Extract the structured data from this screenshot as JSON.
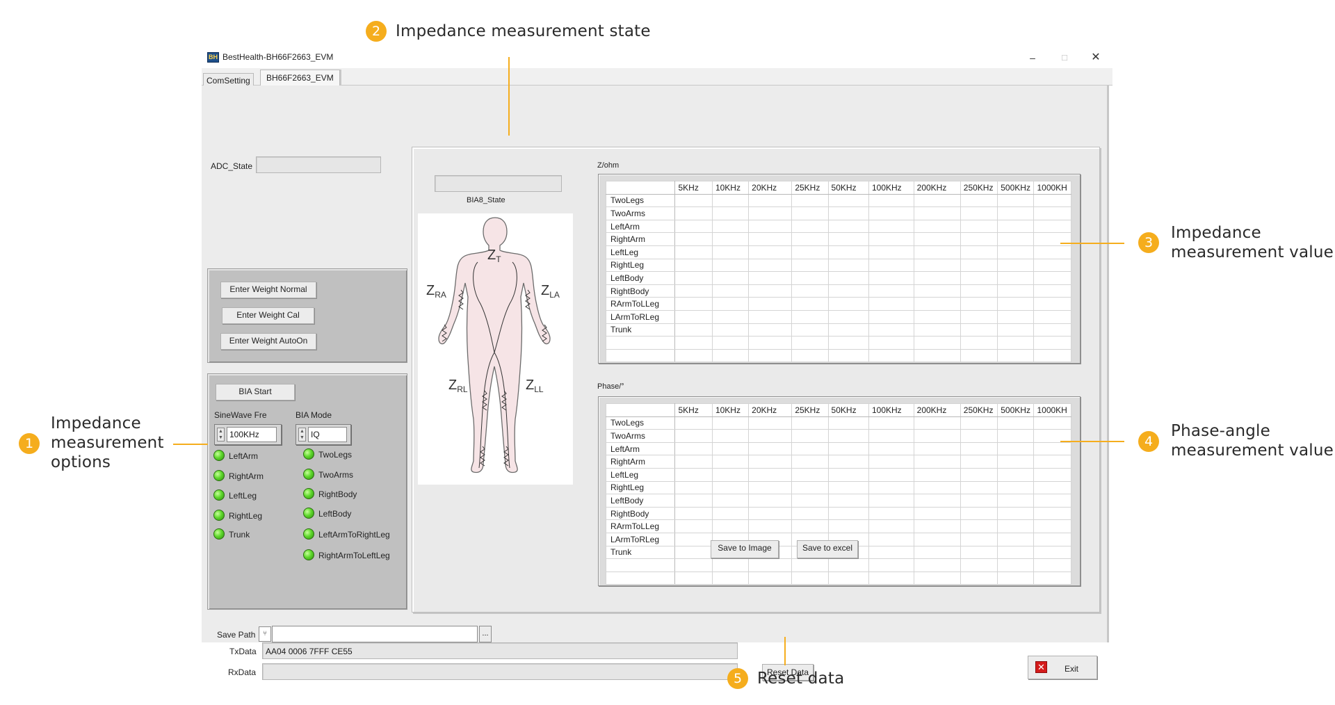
{
  "window": {
    "title": "BestHealth-BH66F2663_EVM",
    "icon_text": "BH",
    "controls": {
      "minimize": "–",
      "maximize": "□",
      "close": "✕"
    }
  },
  "tabs": [
    {
      "label": "ComSetting"
    },
    {
      "label": "BH66F2663_EVM"
    }
  ],
  "adc": {
    "label": "ADC_State",
    "value": ""
  },
  "weight_buttons": {
    "normal": "Enter Weight Normal",
    "cal": "Enter Weight Cal",
    "autoon": "Enter Weight AutoOn"
  },
  "bia": {
    "start_label": "BIA Start",
    "sinewave": {
      "label": "SineWave Fre",
      "value": "100KHz"
    },
    "mode": {
      "label": "BIA Mode",
      "value": "IQ"
    },
    "leds_left": [
      "LeftArm",
      "RightArm",
      "LeftLeg",
      "RightLeg",
      "Trunk"
    ],
    "leds_right": [
      "TwoLegs",
      "TwoArms",
      "RightBody",
      "LeftBody",
      "LeftArmToRightLeg",
      "RightArmToLeftLeg"
    ]
  },
  "bia8_state": {
    "label": "BIA8_State",
    "value": ""
  },
  "body_diagram": {
    "labels": {
      "zt": "Z",
      "zt_sub": "T",
      "zra": "Z",
      "zra_sub": "RA",
      "zla": "Z",
      "zla_sub": "LA",
      "zrl": "Z",
      "zrl_sub": "RL",
      "zll": "Z",
      "zll_sub": "LL"
    },
    "colors": {
      "skin": "#f6e4e6",
      "outline": "#6b6b6b",
      "coil": "#333333"
    }
  },
  "z_table": {
    "label": "Z/ohm",
    "columns": [
      "5KHz",
      "10KHz",
      "20KHz",
      "25KHz",
      "50KHz",
      "100KHz",
      "200KHz",
      "250KHz",
      "500KHz",
      "1000KH"
    ],
    "rows": [
      "TwoLegs",
      "TwoArms",
      "LeftArm",
      "RightArm",
      "LeftLeg",
      "RightLeg",
      "LeftBody",
      "RightBody",
      "RArmToLLeg",
      "LArmToRLeg",
      "Trunk"
    ]
  },
  "phase_table": {
    "label": "Phase/°",
    "columns": [
      "5KHz",
      "10KHz",
      "20KHz",
      "25KHz",
      "50KHz",
      "100KHz",
      "200KHz",
      "250KHz",
      "500KHz",
      "1000KH"
    ],
    "rows": [
      "TwoLegs",
      "TwoArms",
      "LeftArm",
      "RightArm",
      "LeftLeg",
      "RightLeg",
      "LeftBody",
      "RightBody",
      "RArmToLLeg",
      "LArmToRLeg",
      "Trunk"
    ]
  },
  "save_buttons": {
    "image": "Save to Image",
    "excel": "Save to excel"
  },
  "save_path": {
    "label": "Save Path",
    "value": "",
    "browse": "...",
    "icon_text": "⑂"
  },
  "txdata": {
    "label": "TxData",
    "value": "AA04 0006 7FFF CE55"
  },
  "rxdata": {
    "label": "RxData",
    "value": ""
  },
  "reset_label": "Reset Data",
  "exit": {
    "label": "Exit",
    "icon_text": "✕"
  },
  "callouts": [
    {
      "number": "1",
      "lines": [
        "Impedance",
        "measurement",
        "options"
      ]
    },
    {
      "number": "2",
      "lines": [
        "Impedance measurement state"
      ]
    },
    {
      "number": "3",
      "lines": [
        "Impedance",
        "measurement value"
      ]
    },
    {
      "number": "4",
      "lines": [
        "Phase-angle",
        "measurement value"
      ]
    },
    {
      "number": "5",
      "lines": [
        "Reset data"
      ]
    }
  ],
  "accent_color": "#f5ad1d"
}
